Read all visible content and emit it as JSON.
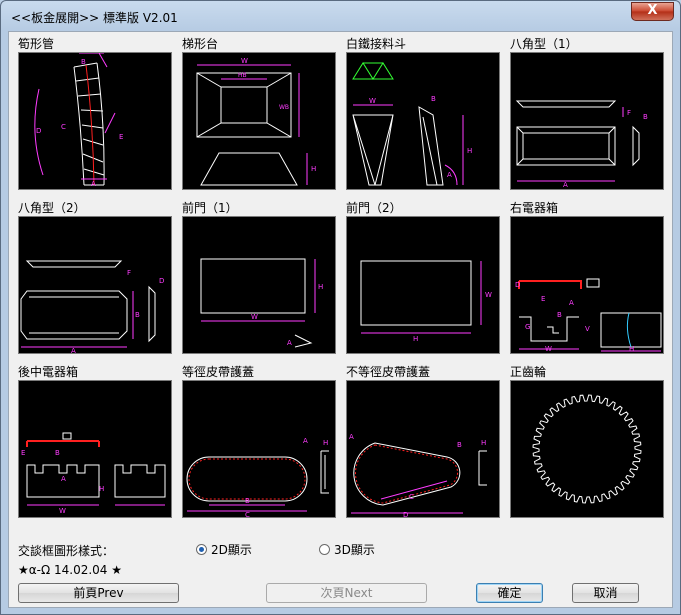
{
  "window": {
    "title": "<<板金展開>>  標準版 V2.01",
    "close_label": "X"
  },
  "cells": [
    {
      "label": "筍形管"
    },
    {
      "label": "梯形台"
    },
    {
      "label": "白鐵接料斗"
    },
    {
      "label": "八角型（1）"
    },
    {
      "label": "八角型（2）"
    },
    {
      "label": "前門（1）"
    },
    {
      "label": "前門（2）"
    },
    {
      "label": "右電器箱"
    },
    {
      "label": "後中電器箱"
    },
    {
      "label": "等徑皮帶護蓋"
    },
    {
      "label": "不等徑皮帶護蓋"
    },
    {
      "label": "正齒輪"
    }
  ],
  "options": {
    "label": "交談框圖形樣式：",
    "radio_2d": "2D顯示",
    "radio_3d": "3D顯示",
    "selected": "2D"
  },
  "version": "★α-Ω 14.02.04 ★",
  "buttons": {
    "prev": "前頁Prev",
    "next": "次頁Next",
    "ok": "確定",
    "cancel": "取消"
  },
  "colors": {
    "magenta": "#ff3cff",
    "white": "#ffffff",
    "red": "#ff2020",
    "green": "#33ff33",
    "yellow": "#ffff55",
    "cyan": "#33ccff"
  },
  "dims": {
    "c1": [
      "B",
      "A",
      "D",
      "C",
      "E"
    ],
    "c2": [
      "W",
      "HB",
      "WB",
      "H"
    ],
    "c3": [
      "W",
      "H",
      "B",
      "A"
    ],
    "c4": [
      "F",
      "B",
      "A"
    ],
    "c5": [
      "F",
      "D",
      "B",
      "A"
    ],
    "c6": [
      "W",
      "H",
      "A"
    ],
    "c7": [
      "W",
      "H"
    ],
    "c8": [
      "D",
      "A",
      "E",
      "G",
      "B",
      "V",
      "W",
      "H"
    ],
    "c9": [
      "E",
      "H",
      "B",
      "A",
      "W"
    ],
    "c10": [
      "A",
      "H",
      "B",
      "C"
    ],
    "c11": [
      "A",
      "B",
      "H",
      "C",
      "D"
    ]
  }
}
